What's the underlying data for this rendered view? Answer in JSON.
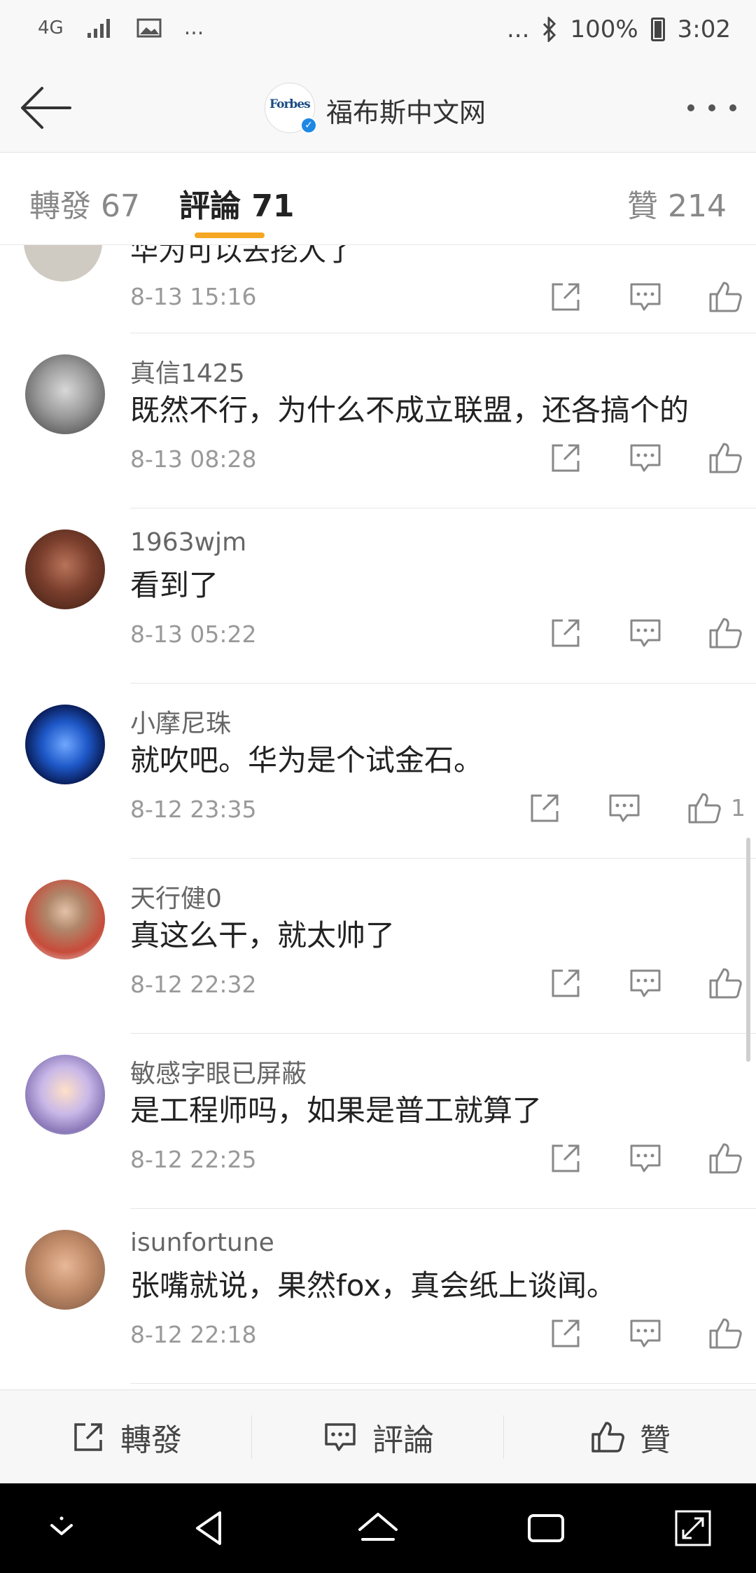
{
  "status_bar": {
    "network": "4G",
    "extra": "...",
    "right_extra": "...",
    "battery": "100%",
    "time": "3:02"
  },
  "header": {
    "logo_text": "Forbes",
    "title": "福布斯中文网"
  },
  "tabs": {
    "repost": "轉發 67",
    "comments": "評論 71",
    "likes": "贊 214"
  },
  "partial_comment": {
    "text": "华为可以去挖人了",
    "time": "8-13 15:16"
  },
  "comments": [
    {
      "user": "真信1425",
      "text": "既然不行，为什么不成立联盟，还各搞个的",
      "time": "8-13 08:28",
      "likes": ""
    },
    {
      "user": "1963wjm",
      "text": "看到了",
      "time": "8-13 05:22",
      "likes": ""
    },
    {
      "user": "小摩尼珠",
      "text": "就吹吧。华为是个试金石。",
      "time": "8-12 23:35",
      "likes": "1"
    },
    {
      "user": "天行健0",
      "text": "真这么干，就太帅了",
      "time": "8-12 22:32",
      "likes": ""
    },
    {
      "user": "敏感字眼已屏蔽",
      "text": "是工程师吗，如果是普工就算了",
      "time": "8-12 22:25",
      "likes": ""
    },
    {
      "user": "isunfortune",
      "text": "张嘴就说，果然fox，真会纸上谈闻。",
      "time": "8-12 22:18",
      "likes": ""
    }
  ],
  "bottom_bar": {
    "repost": "轉發",
    "comment": "評論",
    "like": "贊"
  },
  "colors": {
    "accent": "#f5a623",
    "verified": "#1e88e5"
  }
}
